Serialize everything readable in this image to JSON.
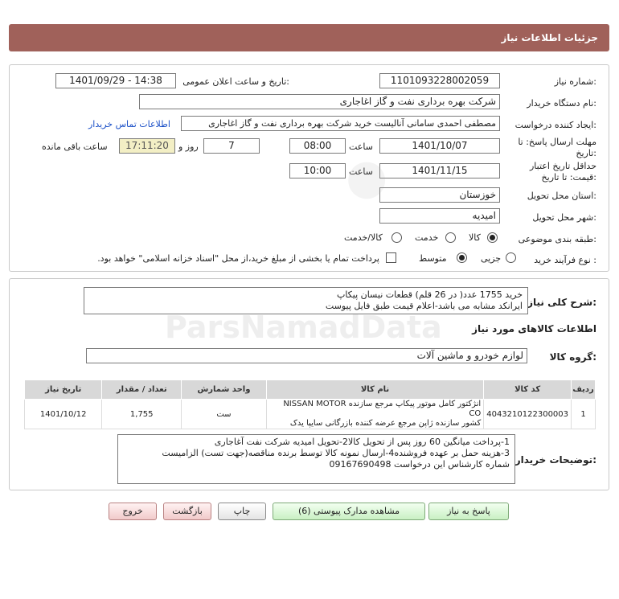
{
  "header": {
    "title": "جزئیات اطلاعات نیاز"
  },
  "fields": {
    "need_number_label": "شماره نیاز:",
    "need_number": "1101093228002059",
    "announce_label": "تاریخ و ساعت اعلان عمومی:",
    "announce_value": "1401/09/29 - 14:38",
    "buyer_org_label": "نام دستگاه خریدار:",
    "buyer_org": "شرکت بهره برداری نفت و گاز اغاجاری",
    "creator_label": "ایجاد کننده درخواست:",
    "creator": "مصطفی احمدی سامانی آنالیست خرید شرکت بهره برداری نفت و گاز اغاجاری",
    "contact_link": "اطلاعات تماس خریدار",
    "deadline_label_1": "مهلت ارسال پاسخ: تا",
    "deadline_label_2": "تاریخ:",
    "deadline_date": "1401/10/07",
    "time_label": "ساعت",
    "deadline_time": "08:00",
    "days": "7",
    "days_label": "روز و",
    "remaining_time": "17:11:20",
    "remaining_label": "ساعت باقی مانده",
    "validity_label_1": "حداقل تاریخ اعتبار",
    "validity_label_2": "قیمت: تا تاریخ:",
    "validity_date": "1401/11/15",
    "validity_time": "10:00",
    "province_label": "استان محل تحویل:",
    "province": "خوزستان",
    "city_label": "شهر محل تحویل:",
    "city": "امیدیه",
    "category_label": "طبقه بندی موضوعی:",
    "category_options": [
      "کالا",
      "خدمت",
      "کالا/خدمت"
    ],
    "purchase_type_label": "نوع فرآیند خرید :",
    "purchase_options": [
      "جزیی",
      "متوسط"
    ],
    "treasury_note": "پرداخت تمام یا بخشی از مبلغ خرید،از محل \"اسناد خزانه اسلامی\" خواهد بود."
  },
  "summary": {
    "label": "شرح کلی نیاز:",
    "line1": "خرید 1755 عدد( در 26 قلم) قطعات نیسان پیکاپ",
    "line2": "ایرانکد مشابه می باشد-اعلام قیمت طبق فایل پیوست"
  },
  "goods_info_title": "اطلاعات کالاهای مورد نیاز",
  "goods_group_label": "گروه کالا:",
  "goods_group": "لوازم خودرو و ماشین آلات",
  "table": {
    "headers": [
      "ردیف",
      "کد کالا",
      "نام کالا",
      "واحد شمارش",
      "تعداد / مقدار",
      "تاریخ نیاز"
    ],
    "rows": [
      {
        "row": "1",
        "code": "4043210122300003",
        "name_1": "انژکتور کامل موتور پیکاپ مرجع سازنده NISSAN MOTOR CO",
        "name_2": "کشور سازنده ژاپن مرجع عرضه کننده بازرگانی سایپا یدک",
        "unit": "ست",
        "qty": "1,755",
        "date": "1401/10/12"
      }
    ]
  },
  "buyer_notes": {
    "label": "توضیحات خریدار:",
    "line1": "1-پرداخت میانگین 60 روز پس از تحویل کالا2-تحویل امیدیه شرکت نفت آغاجاری",
    "line2": "3-هزینه حمل بر عهده فروشنده4-ارسال نمونه کالا توسط برنده مناقصه(جهت تست) الزامیست",
    "line3": "شماره کارشناس این درخواست 09167690498"
  },
  "buttons": {
    "reply": "پاسخ به نیاز",
    "docs": "مشاهده مدارک پیوستی (6)",
    "print": "چاپ",
    "back": "بازگشت",
    "exit": "خروج"
  },
  "watermark": {
    "brand": "ParsNamadData"
  },
  "colors": {
    "title_bar": "#a0615a",
    "link": "#1a4fc7",
    "remaining_bg": "#f3efc5"
  }
}
